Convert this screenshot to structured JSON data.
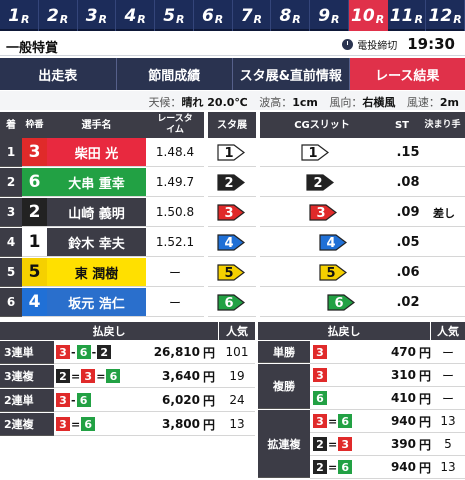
{
  "races": [
    {
      "num": "1",
      "suffix": "R"
    },
    {
      "num": "2",
      "suffix": "R"
    },
    {
      "num": "3",
      "suffix": "R"
    },
    {
      "num": "4",
      "suffix": "R"
    },
    {
      "num": "5",
      "suffix": "R"
    },
    {
      "num": "6",
      "suffix": "R"
    },
    {
      "num": "7",
      "suffix": "R"
    },
    {
      "num": "8",
      "suffix": "R"
    },
    {
      "num": "9",
      "suffix": "R"
    },
    {
      "num": "10",
      "suffix": "R"
    },
    {
      "num": "11",
      "suffix": "R"
    },
    {
      "num": "12",
      "suffix": "R"
    }
  ],
  "active_race": 9,
  "title": {
    "race_name": "一般特賞",
    "deadline_label": "電投締切",
    "deadline_time": "19:30"
  },
  "menu": [
    "出走表",
    "節間成績",
    "スタ展&直前情報",
    "レース結果"
  ],
  "active_menu": 3,
  "weather": {
    "label_weather": "天候：",
    "weather": "晴れ 20.0℃",
    "label_wave": "波高：",
    "wave": "1cm",
    "label_wind": "風向：",
    "wind": "右横風",
    "label_speed": "風速：",
    "speed": "2m"
  },
  "entry_headers": {
    "pos": "着",
    "waku": "枠番",
    "name": "選手名",
    "time": "レースタイム",
    "st_ex": "スタ展",
    "cg": "CGスリット",
    "st": "ST",
    "kimari": "決まり手"
  },
  "entries": [
    {
      "pos": "1",
      "waku": "3",
      "name": "柴田 光",
      "time": "1.48.4",
      "stex": "1",
      "cg": "1",
      "st": ".15",
      "kimari": ""
    },
    {
      "pos": "2",
      "waku": "6",
      "name": "大串 重幸",
      "time": "1.49.7",
      "stex": "2",
      "cg": "2",
      "st": ".08",
      "kimari": ""
    },
    {
      "pos": "3",
      "waku": "2",
      "name": "山崎 義明",
      "time": "1.50.8",
      "stex": "3",
      "cg": "3",
      "st": ".09",
      "kimari": "差し"
    },
    {
      "pos": "4",
      "waku": "1",
      "name": "鈴木 幸夫",
      "time": "1.52.1",
      "stex": "4",
      "cg": "4",
      "st": ".05",
      "kimari": ""
    },
    {
      "pos": "5",
      "waku": "5",
      "name": "東 潤樹",
      "time": "ー",
      "stex": "5",
      "cg": "5",
      "st": ".06",
      "kimari": ""
    },
    {
      "pos": "6",
      "waku": "4",
      "name": "坂元 浩仁",
      "time": "ー",
      "stex": "6",
      "cg": "6",
      "st": ".02",
      "kimari": ""
    }
  ],
  "pay_headers": {
    "payout": "払戻し",
    "pop": "人気"
  },
  "payouts_left": [
    {
      "type": "3連単",
      "combo": [
        "3",
        "-",
        "6",
        "-",
        "2"
      ],
      "amount": "26,810",
      "unit": "円",
      "pop": "101"
    },
    {
      "type": "3連複",
      "combo": [
        "2",
        "=",
        "3",
        "=",
        "6"
      ],
      "amount": "3,640",
      "unit": "円",
      "pop": "19"
    },
    {
      "type": "2連単",
      "combo": [
        "3",
        "-",
        "6"
      ],
      "amount": "6,020",
      "unit": "円",
      "pop": "24"
    },
    {
      "type": "2連複",
      "combo": [
        "3",
        "=",
        "6"
      ],
      "amount": "3,800",
      "unit": "円",
      "pop": "13"
    }
  ],
  "payouts_right": [
    {
      "type": "単勝",
      "combo": [
        "3"
      ],
      "amount": "470",
      "unit": "円",
      "pop": "ー"
    },
    {
      "type": "複勝",
      "combo": [
        "3"
      ],
      "amount": "310",
      "unit": "円",
      "pop": "ー"
    },
    {
      "type": "",
      "combo": [
        "6"
      ],
      "amount": "410",
      "unit": "円",
      "pop": "ー"
    },
    {
      "type": "拡連複",
      "combo": [
        "3",
        "=",
        "6"
      ],
      "amount": "940",
      "unit": "円",
      "pop": "13"
    },
    {
      "type": "",
      "combo": [
        "2",
        "=",
        "3"
      ],
      "amount": "390",
      "unit": "円",
      "pop": "5"
    },
    {
      "type": "",
      "combo": [
        "2",
        "=",
        "6"
      ],
      "amount": "940",
      "unit": "円",
      "pop": "13"
    }
  ],
  "colors": {
    "w1": "#ffffff",
    "w2": "#222222",
    "w3": "#e02a2a",
    "w4": "#2070d6",
    "w5": "#f5d000",
    "w6": "#22a144",
    "accent": "#e0314a",
    "navy": "#1c2c5a"
  }
}
